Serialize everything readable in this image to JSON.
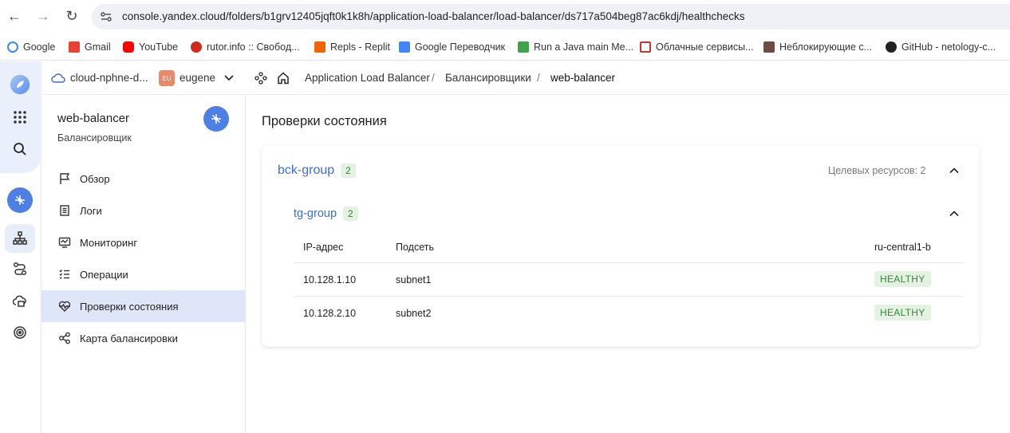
{
  "browser": {
    "url": "console.yandex.cloud/folders/b1grv12405jqft0k1k8h/application-load-balancer/load-balancer/ds717a504beg87ac6kdj/healthchecks",
    "bookmarks": [
      {
        "label": "Google",
        "icon": "google-icon",
        "color": "#4285f4"
      },
      {
        "label": "Gmail",
        "icon": "gmail-icon",
        "color": "#ea4335"
      },
      {
        "label": "YouTube",
        "icon": "youtube-icon",
        "color": "#ff0000"
      },
      {
        "label": "rutor.info :: Свобод...",
        "icon": "rutor-icon",
        "color": "#d02a1e"
      },
      {
        "label": "Repls - Replit",
        "icon": "replit-icon",
        "color": "#f26207"
      },
      {
        "label": "Google Переводчик",
        "icon": "translate-icon",
        "color": "#4285f4"
      },
      {
        "label": "Run a Java main Me...",
        "icon": "java-icon",
        "color": "#3fa34d"
      },
      {
        "label": "Облачные сервисы...",
        "icon": "cloud-service-icon",
        "color": "#c0392b"
      },
      {
        "label": "Неблокирующие с...",
        "icon": "coffee-icon",
        "color": "#6d4c41"
      },
      {
        "label": "GitHub - netology-c...",
        "icon": "github-icon",
        "color": "#222222"
      }
    ]
  },
  "topbar": {
    "cloud": "cloud-nphne-d...",
    "user_initials": "EU",
    "user": "eugene",
    "crumbs": [
      "Application Load Balancer",
      "Балансировщики",
      "web-balancer"
    ],
    "separator": "/"
  },
  "resource": {
    "name": "web-balancer",
    "type": "Балансировщик"
  },
  "nav": [
    {
      "label": "Обзор",
      "icon": "flag-icon"
    },
    {
      "label": "Логи",
      "icon": "logs-icon"
    },
    {
      "label": "Мониторинг",
      "icon": "monitoring-icon"
    },
    {
      "label": "Операции",
      "icon": "operations-icon"
    },
    {
      "label": "Проверки состояния",
      "icon": "healthcheck-icon",
      "active": true
    },
    {
      "label": "Карта балансировки",
      "icon": "map-icon"
    }
  ],
  "page": {
    "title": "Проверки состояния",
    "backend_group": {
      "name": "bck-group",
      "count": "2",
      "targets_label": "Целевых ресурсов: 2"
    },
    "target_group": {
      "name": "tg-group",
      "count": "2",
      "columns": [
        "IP-адрес",
        "Подсеть",
        "ru-central1-b"
      ],
      "rows": [
        {
          "ip": "10.128.1.10",
          "subnet": "subnet1",
          "status": "HEALTHY"
        },
        {
          "ip": "10.128.2.10",
          "subnet": "subnet2",
          "status": "HEALTHY"
        }
      ]
    }
  },
  "colors": {
    "accent": "#4d7fe5",
    "link": "#3a6fd9",
    "healthy_bg": "#e4f3e1",
    "healthy_text": "#2d8a33"
  }
}
